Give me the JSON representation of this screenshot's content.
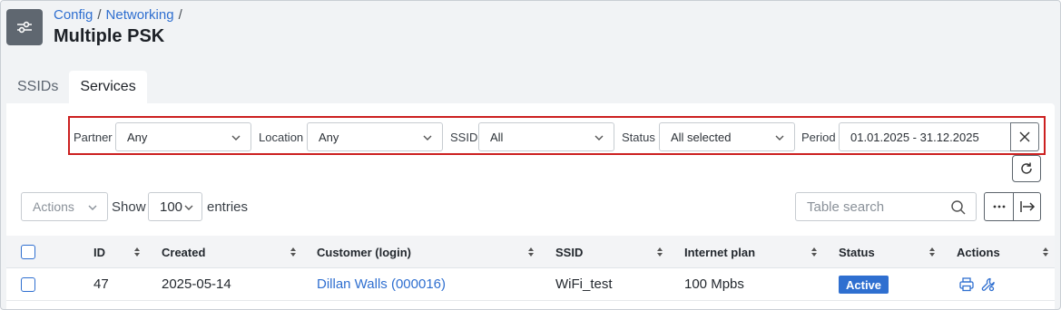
{
  "breadcrumb": {
    "item1": "Config",
    "sep1": "/",
    "item2": "Networking",
    "sep2": "/"
  },
  "page": {
    "title": "Multiple PSK"
  },
  "tabs": [
    {
      "label": "SSIDs"
    },
    {
      "label": "Services"
    }
  ],
  "filters": {
    "partner": {
      "label": "Partner",
      "value": "Any"
    },
    "location": {
      "label": "Location",
      "value": "Any"
    },
    "ssid": {
      "label": "SSID",
      "value": "All"
    },
    "status": {
      "label": "Status",
      "value": "All selected"
    },
    "period": {
      "label": "Period",
      "value": "01.01.2025 - 31.12.2025"
    }
  },
  "toolbar": {
    "actions_label": "Actions",
    "show_label": "Show",
    "entries_value": "100",
    "entries_label": "entries",
    "search_placeholder": "Table search"
  },
  "table": {
    "columns": [
      "ID",
      "Created",
      "Customer (login)",
      "SSID",
      "Internet plan",
      "Status",
      "Actions"
    ],
    "rows": [
      {
        "id": "47",
        "created": "2025-05-14",
        "customer": "Dillan Walls (000016)",
        "ssid": "WiFi_test",
        "plan": "100 Mpbs",
        "status": "Active"
      }
    ]
  },
  "colors": {
    "accent": "#2f6fd0",
    "highlight_border": "#cc2020",
    "page_bg": "#f1f3f5"
  }
}
